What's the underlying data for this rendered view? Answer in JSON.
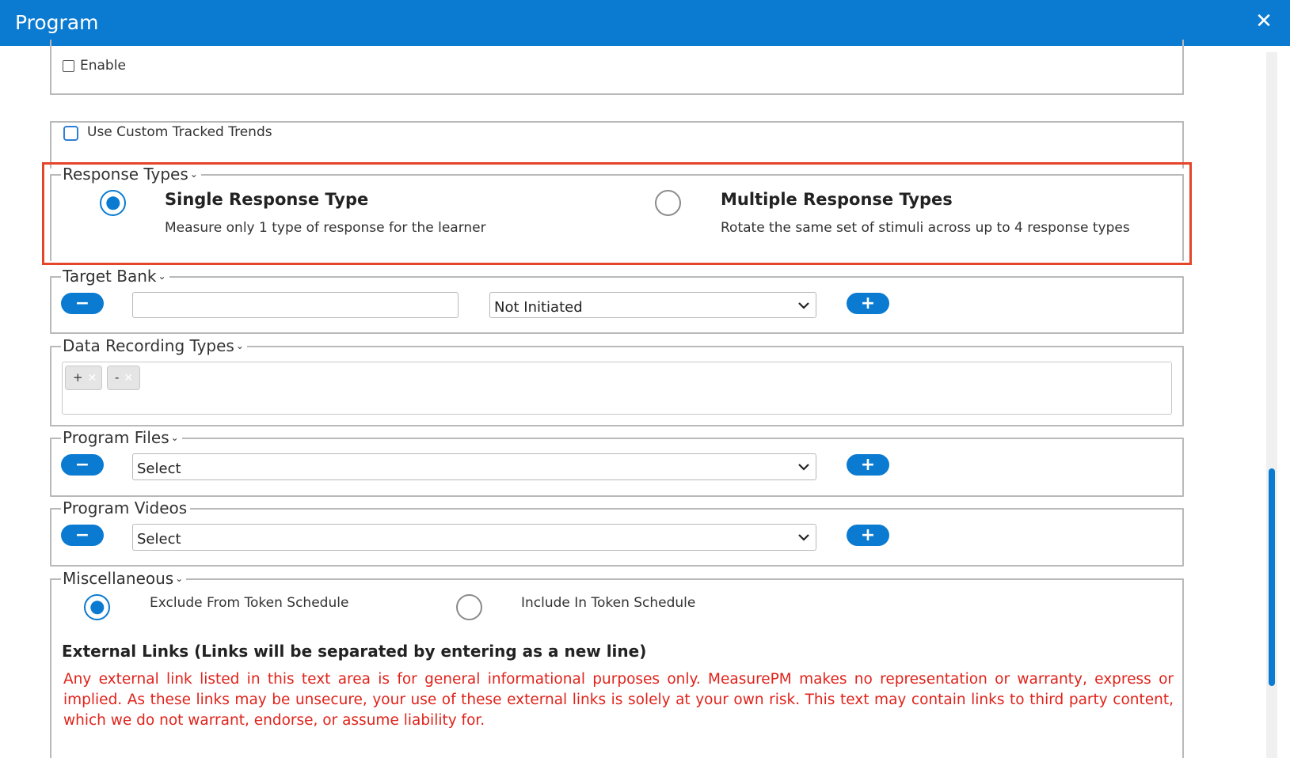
{
  "window": {
    "title": "Program",
    "close_label": "✕"
  },
  "top_section": {
    "enable_label": "Enable"
  },
  "tracked_trends": {
    "label": "Use Custom Tracked Trends"
  },
  "response_types": {
    "legend": "Response Types",
    "single": {
      "title": "Single Response Type",
      "description": "Measure only 1 type of response for the learner",
      "selected": true
    },
    "multiple": {
      "title": "Multiple Response Types",
      "description": "Rotate the same set of stimuli across up to 4 response types",
      "selected": false
    }
  },
  "target_bank": {
    "legend": "Target Bank",
    "target_value": "",
    "status_selected": "Not Initiated",
    "remove_label": "−",
    "add_label": "+"
  },
  "data_recording_types": {
    "legend": "Data Recording Types",
    "tags": [
      "+",
      "-"
    ]
  },
  "program_files": {
    "legend": "Program Files",
    "selected": "Select",
    "remove_label": "−",
    "add_label": "+"
  },
  "program_videos": {
    "legend": "Program Videos",
    "selected": "Select",
    "remove_label": "−",
    "add_label": "+"
  },
  "miscellaneous": {
    "legend": "Miscellaneous",
    "exclude_label": "Exclude From Token Schedule",
    "include_label": "Include In Token Schedule",
    "exclude_selected": true,
    "external_links_heading": "External Links (Links will be separated by entering as a new line)",
    "disclaimer": "Any external link listed in this text area is for general informational purposes only. MeasurePM makes no representation or warranty, express or implied. As these links may be unsecure, your use of these external links is solely at your own risk. This text may contain links to third party content, which we do not warrant, endorse, or assume liability for."
  },
  "colors": {
    "accent": "#0a7bd1",
    "highlight_border": "#e54528",
    "warning_text": "#e0231b"
  }
}
